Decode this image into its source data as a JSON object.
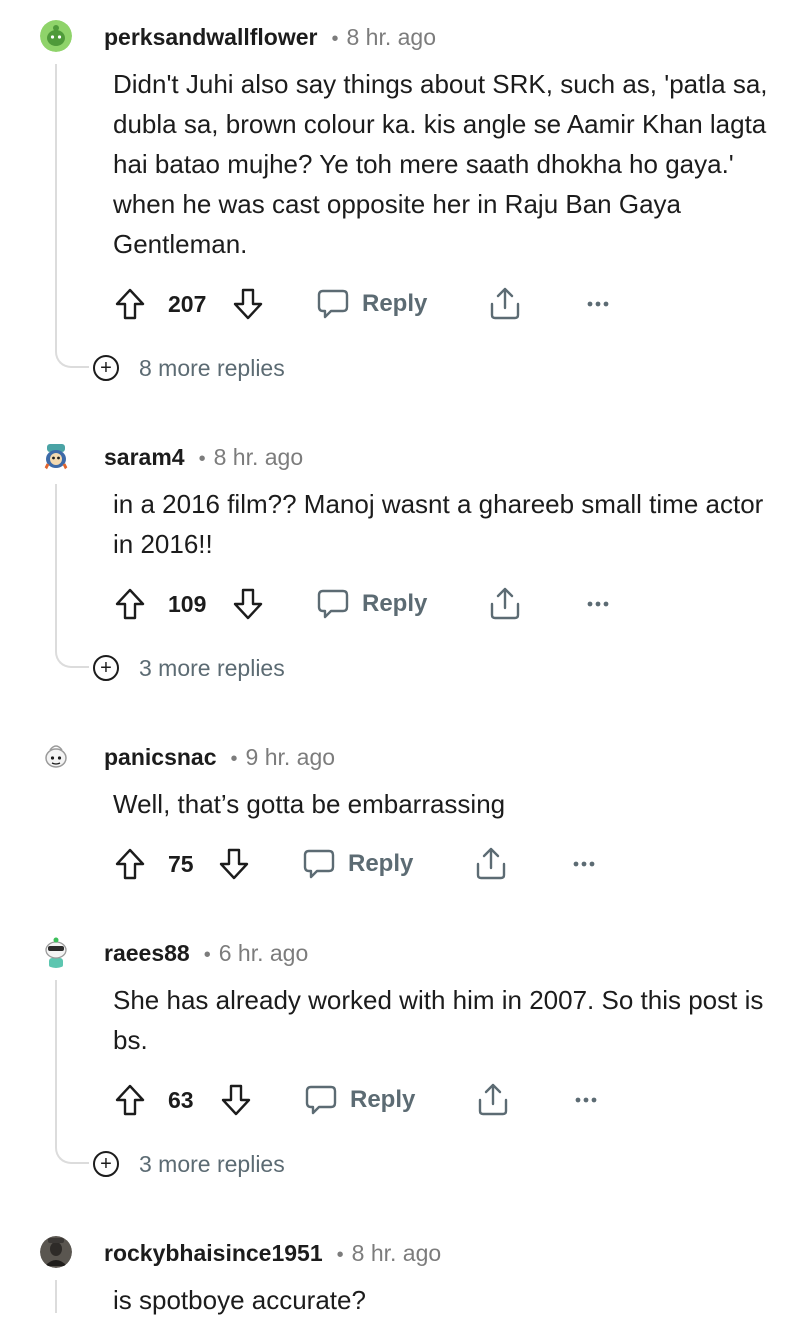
{
  "comments": [
    {
      "username": "perksandwallflower",
      "time": "8 hr. ago",
      "body": "Didn't Juhi also say things about SRK, such as, 'patla sa, dubla sa, brown colour ka. kis angle se Aamir Khan lagta hai batao mujhe? Ye toh mere saath dhokha ho gaya.' when he was cast opposite her in Raju Ban Gaya Gentleman.",
      "score": "207",
      "reply_label": "Reply",
      "more_replies": "8 more replies"
    },
    {
      "username": "saram4",
      "time": "8 hr. ago",
      "body": "in a 2016 film?? Manoj wasnt a ghareeb small time actor in 2016!!",
      "score": "109",
      "reply_label": "Reply",
      "more_replies": "3 more replies"
    },
    {
      "username": "panicsnac",
      "time": "9 hr. ago",
      "body": "Well, that’s gotta be embarrassing",
      "score": "75",
      "reply_label": "Reply"
    },
    {
      "username": "raees88",
      "time": "6 hr. ago",
      "body": "She has already worked with him in 2007. So this post is bs.",
      "score": "63",
      "reply_label": "Reply",
      "more_replies": "3 more replies"
    },
    {
      "username": "rockybhaisince1951",
      "time": "8 hr. ago",
      "body": "is spotboye accurate?"
    }
  ],
  "meta_separator": "•",
  "more_icon": "+",
  "icons": {
    "upvote": "arrow-up-outline-icon",
    "downvote": "arrow-down-outline-icon",
    "reply": "speech-bubble-icon",
    "share": "share-upload-icon",
    "overflow": "ellipsis-icon"
  },
  "colors": {
    "text": "#1c1c1c",
    "muted": "#7c7c7c",
    "action": "#5c6b73",
    "thread": "#dcdcdc"
  }
}
